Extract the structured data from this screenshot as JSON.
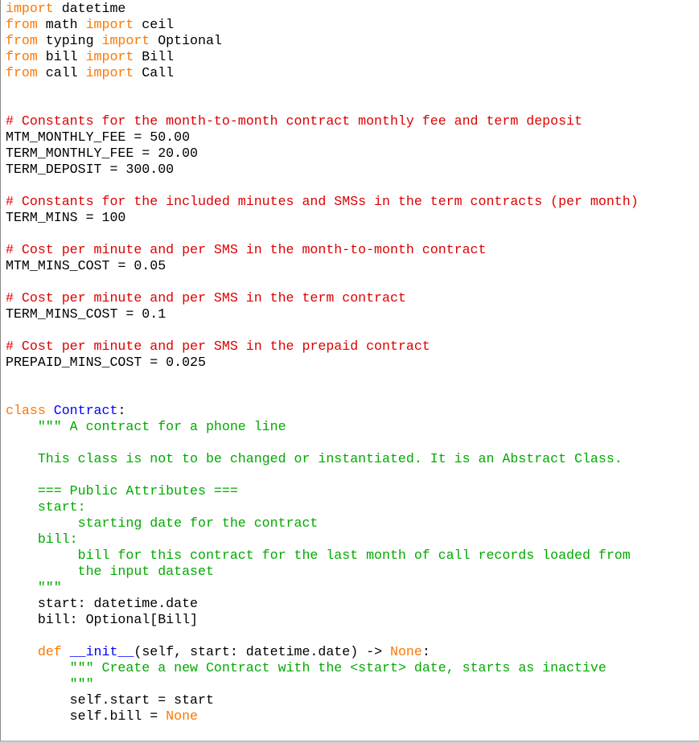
{
  "editor": {
    "colors": {
      "keyword": "#ff7700",
      "comment": "#dd0000",
      "string": "#00aa00",
      "definition": "#0000ff",
      "default": "#000000",
      "background": "#ffffff"
    },
    "lines": [
      [
        {
          "t": "kw",
          "v": "import"
        },
        {
          "t": "",
          "v": " datetime"
        }
      ],
      [
        {
          "t": "kw",
          "v": "from"
        },
        {
          "t": "",
          "v": " math "
        },
        {
          "t": "kw",
          "v": "import"
        },
        {
          "t": "",
          "v": " ceil"
        }
      ],
      [
        {
          "t": "kw",
          "v": "from"
        },
        {
          "t": "",
          "v": " typing "
        },
        {
          "t": "kw",
          "v": "import"
        },
        {
          "t": "",
          "v": " Optional"
        }
      ],
      [
        {
          "t": "kw",
          "v": "from"
        },
        {
          "t": "",
          "v": " bill "
        },
        {
          "t": "kw",
          "v": "import"
        },
        {
          "t": "",
          "v": " Bill"
        }
      ],
      [
        {
          "t": "kw",
          "v": "from"
        },
        {
          "t": "",
          "v": " call "
        },
        {
          "t": "kw",
          "v": "import"
        },
        {
          "t": "",
          "v": " Call"
        }
      ],
      [],
      [],
      [
        {
          "t": "cm",
          "v": "# Constants for the month-to-month contract monthly fee and term deposit"
        }
      ],
      [
        {
          "t": "",
          "v": "MTM_MONTHLY_FEE = 50.00"
        }
      ],
      [
        {
          "t": "",
          "v": "TERM_MONTHLY_FEE = 20.00"
        }
      ],
      [
        {
          "t": "",
          "v": "TERM_DEPOSIT = 300.00"
        }
      ],
      [],
      [
        {
          "t": "cm",
          "v": "# Constants for the included minutes and SMSs in the term contracts (per month)"
        }
      ],
      [
        {
          "t": "",
          "v": "TERM_MINS = 100"
        }
      ],
      [],
      [
        {
          "t": "cm",
          "v": "# Cost per minute and per SMS in the month-to-month contract"
        }
      ],
      [
        {
          "t": "",
          "v": "MTM_MINS_COST = 0.05"
        }
      ],
      [],
      [
        {
          "t": "cm",
          "v": "# Cost per minute and per SMS in the term contract"
        }
      ],
      [
        {
          "t": "",
          "v": "TERM_MINS_COST = 0.1"
        }
      ],
      [],
      [
        {
          "t": "cm",
          "v": "# Cost per minute and per SMS in the prepaid contract"
        }
      ],
      [
        {
          "t": "",
          "v": "PREPAID_MINS_COST = 0.025"
        }
      ],
      [],
      [],
      [
        {
          "t": "kw",
          "v": "class"
        },
        {
          "t": "",
          "v": " "
        },
        {
          "t": "df",
          "v": "Contract"
        },
        {
          "t": "",
          "v": ":"
        }
      ],
      [
        {
          "t": "",
          "v": "    "
        },
        {
          "t": "st",
          "v": "\"\"\" A contract for a phone line"
        }
      ],
      [],
      [
        {
          "t": "st",
          "v": "    This class is not to be changed or instantiated. It is an Abstract Class."
        }
      ],
      [],
      [
        {
          "t": "st",
          "v": "    === Public Attributes ==="
        }
      ],
      [
        {
          "t": "st",
          "v": "    start:"
        }
      ],
      [
        {
          "t": "st",
          "v": "         starting date for the contract"
        }
      ],
      [
        {
          "t": "st",
          "v": "    bill:"
        }
      ],
      [
        {
          "t": "st",
          "v": "         bill for this contract for the last month of call records loaded from"
        }
      ],
      [
        {
          "t": "st",
          "v": "         the input dataset"
        }
      ],
      [
        {
          "t": "st",
          "v": "    \"\"\""
        }
      ],
      [
        {
          "t": "",
          "v": "    start: datetime.date"
        }
      ],
      [
        {
          "t": "",
          "v": "    bill: Optional[Bill]"
        }
      ],
      [],
      [
        {
          "t": "",
          "v": "    "
        },
        {
          "t": "kw",
          "v": "def"
        },
        {
          "t": "",
          "v": " "
        },
        {
          "t": "df",
          "v": "__init__"
        },
        {
          "t": "",
          "v": "(self, start: datetime.date) -> "
        },
        {
          "t": "kw",
          "v": "None"
        },
        {
          "t": "",
          "v": ":"
        }
      ],
      [
        {
          "t": "",
          "v": "        "
        },
        {
          "t": "st",
          "v": "\"\"\" Create a new Contract with the <start> date, starts as inactive"
        }
      ],
      [
        {
          "t": "st",
          "v": "        \"\"\""
        }
      ],
      [
        {
          "t": "",
          "v": "        self.start = start"
        }
      ],
      [
        {
          "t": "",
          "v": "        self.bill = "
        },
        {
          "t": "kw",
          "v": "None"
        }
      ]
    ]
  }
}
